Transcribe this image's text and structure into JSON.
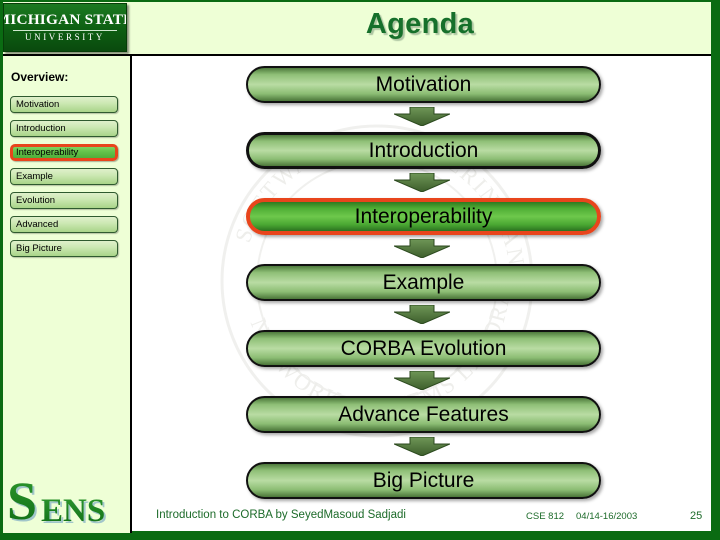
{
  "branding": {
    "university_line1": "MICHIGAN STATE",
    "university_line2": "UNIVERSITY",
    "lab_logo_text": "SENS"
  },
  "header": {
    "title": "Agenda"
  },
  "sidebar": {
    "heading": "Overview:",
    "items": [
      {
        "label": "Motivation",
        "active": false
      },
      {
        "label": "Introduction",
        "active": false
      },
      {
        "label": "Interoperability",
        "active": true
      },
      {
        "label": "Example",
        "active": false
      },
      {
        "label": "Evolution",
        "active": false
      },
      {
        "label": "Advanced",
        "active": false
      },
      {
        "label": "Big Picture",
        "active": false
      }
    ]
  },
  "main": {
    "flow_nodes": [
      {
        "label": "Motivation",
        "highlighted": false
      },
      {
        "label": "Introduction",
        "highlighted": false
      },
      {
        "label": "Interoperability",
        "highlighted": true
      },
      {
        "label": "Example",
        "highlighted": false
      },
      {
        "label": "CORBA Evolution",
        "highlighted": false
      },
      {
        "label": "Advance Features",
        "highlighted": false
      },
      {
        "label": "Big Picture",
        "highlighted": false
      }
    ],
    "arrow_count": 6
  },
  "footer": {
    "attribution": "Introduction to CORBA by SeyedMasoud Sadjadi",
    "course": "CSE 812",
    "date": "04/14-16/2003",
    "page_number": "25"
  },
  "colors": {
    "frame_green": "#0a6b12",
    "header_bg": "#eeffd6",
    "title_green": "#16702b",
    "highlight_orange": "#e8451c",
    "node_green": "#b9dca3",
    "footer_green": "#1d6b2a"
  }
}
